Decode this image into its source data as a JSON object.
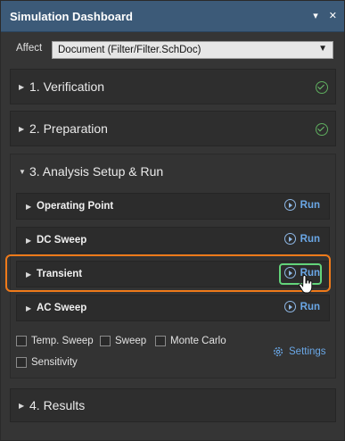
{
  "window": {
    "title": "Simulation Dashboard",
    "pin_icon": "pin-down-icon",
    "close_icon": "close-icon"
  },
  "affect": {
    "label": "Affect",
    "value": "Document (Filter/Filter.SchDoc)"
  },
  "sections": {
    "verification": {
      "title": "1. Verification",
      "status": "check-icon"
    },
    "preparation": {
      "title": "2. Preparation",
      "status": "check-icon"
    },
    "analysis": {
      "title": "3. Analysis Setup & Run"
    },
    "results": {
      "title": "4. Results"
    }
  },
  "analyses": [
    {
      "name": "Operating Point",
      "run": "Run"
    },
    {
      "name": "DC Sweep",
      "run": "Run"
    },
    {
      "name": "Transient",
      "run": "Run"
    },
    {
      "name": "AC Sweep",
      "run": "Run"
    }
  ],
  "options": {
    "temp_sweep": "Temp. Sweep",
    "sweep": "Sweep",
    "monte_carlo": "Monte Carlo",
    "sensitivity": "Sensitivity"
  },
  "settings_label": "Settings",
  "colors": {
    "titlebar": "#3c5a78",
    "accent": "#6aa7e6",
    "highlight": "#ef7a1a",
    "run_highlight": "#63d37a",
    "check": "#5fae5f"
  }
}
